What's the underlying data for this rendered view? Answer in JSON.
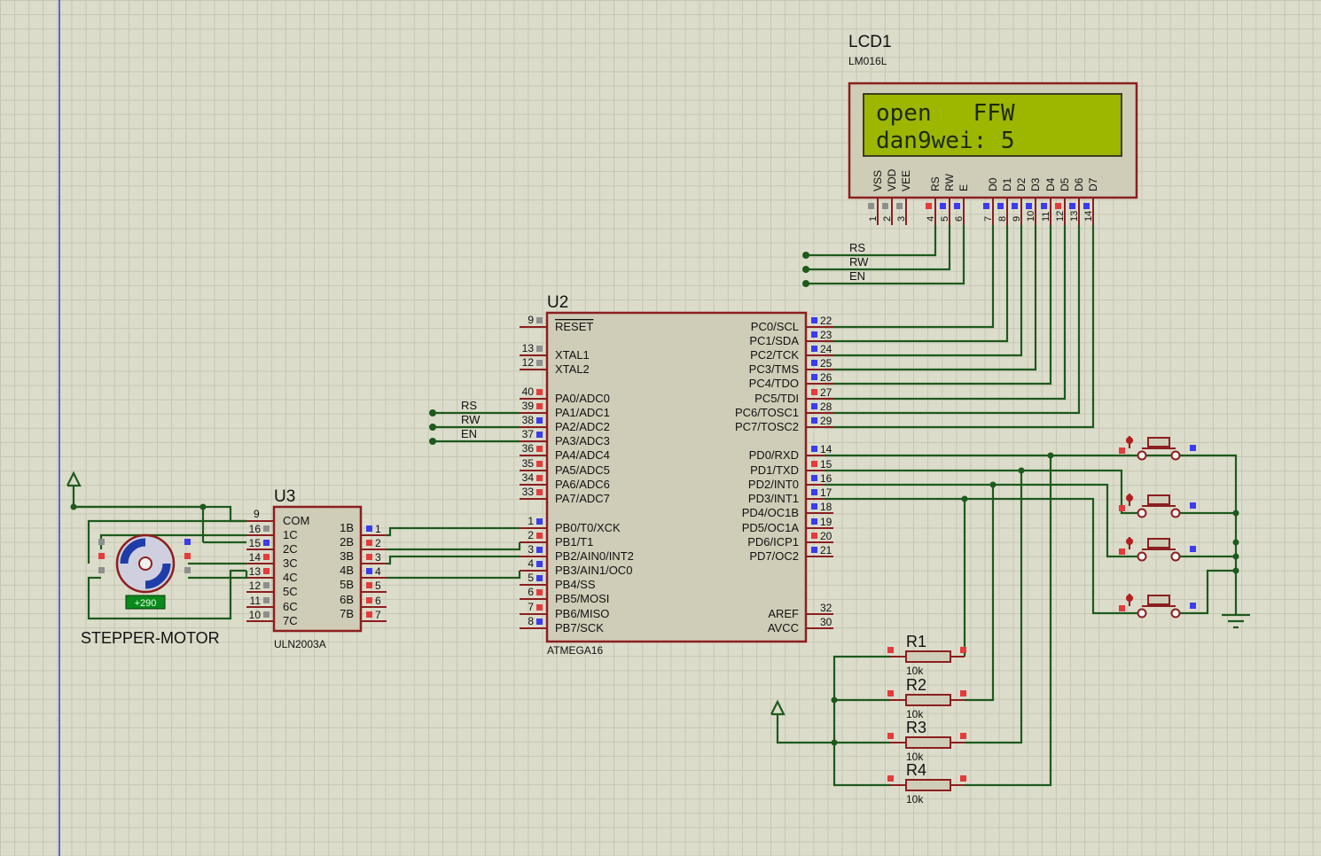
{
  "lcd": {
    "ref": "LCD1",
    "model": "LM016L",
    "line1": "open   FFW",
    "line2": "dan9wei: 5",
    "pin_labels": [
      "VSS",
      "VDD",
      "VEE",
      "RS",
      "RW",
      "E",
      "D0",
      "D1",
      "D2",
      "D3",
      "D4",
      "D5",
      "D6",
      "D7"
    ],
    "pin_numbers": [
      "1",
      "2",
      "3",
      "4",
      "5",
      "6",
      "7",
      "8",
      "9",
      "10",
      "11",
      "12",
      "13",
      "14"
    ]
  },
  "mcu": {
    "ref": "U2",
    "model": "ATMEGA16",
    "left_pins": [
      {
        "num": "9",
        "name": "RESET"
      },
      {
        "num": "13",
        "name": "XTAL1"
      },
      {
        "num": "12",
        "name": "XTAL2"
      },
      {
        "num": "40",
        "name": "PA0/ADC0"
      },
      {
        "num": "39",
        "name": "PA1/ADC1"
      },
      {
        "num": "38",
        "name": "PA2/ADC2"
      },
      {
        "num": "37",
        "name": "PA3/ADC3"
      },
      {
        "num": "36",
        "name": "PA4/ADC4"
      },
      {
        "num": "35",
        "name": "PA5/ADC5"
      },
      {
        "num": "34",
        "name": "PA6/ADC6"
      },
      {
        "num": "33",
        "name": "PA7/ADC7"
      },
      {
        "num": "1",
        "name": "PB0/T0/XCK"
      },
      {
        "num": "2",
        "name": "PB1/T1"
      },
      {
        "num": "3",
        "name": "PB2/AIN0/INT2"
      },
      {
        "num": "4",
        "name": "PB3/AIN1/OC0"
      },
      {
        "num": "5",
        "name": "PB4/SS"
      },
      {
        "num": "6",
        "name": "PB5/MOSI"
      },
      {
        "num": "7",
        "name": "PB6/MISO"
      },
      {
        "num": "8",
        "name": "PB7/SCK"
      }
    ],
    "right_pins": [
      {
        "num": "22",
        "name": "PC0/SCL"
      },
      {
        "num": "23",
        "name": "PC1/SDA"
      },
      {
        "num": "24",
        "name": "PC2/TCK"
      },
      {
        "num": "25",
        "name": "PC3/TMS"
      },
      {
        "num": "26",
        "name": "PC4/TDO"
      },
      {
        "num": "27",
        "name": "PC5/TDI"
      },
      {
        "num": "28",
        "name": "PC6/TOSC1"
      },
      {
        "num": "29",
        "name": "PC7/TOSC2"
      },
      {
        "num": "14",
        "name": "PD0/RXD"
      },
      {
        "num": "15",
        "name": "PD1/TXD"
      },
      {
        "num": "16",
        "name": "PD2/INT0"
      },
      {
        "num": "17",
        "name": "PD3/INT1"
      },
      {
        "num": "18",
        "name": "PD4/OC1B"
      },
      {
        "num": "19",
        "name": "PD5/OC1A"
      },
      {
        "num": "20",
        "name": "PD6/ICP1"
      },
      {
        "num": "21",
        "name": "PD7/OC2"
      },
      {
        "num": "32",
        "name": "AREF"
      },
      {
        "num": "30",
        "name": "AVCC"
      }
    ]
  },
  "driver": {
    "ref": "U3",
    "model": "ULN2003A",
    "com_label": "COM",
    "com_pin": "9",
    "left_pins": [
      {
        "num": "16",
        "name": "1C"
      },
      {
        "num": "15",
        "name": "2C"
      },
      {
        "num": "14",
        "name": "3C"
      },
      {
        "num": "13",
        "name": "4C"
      },
      {
        "num": "12",
        "name": "5C"
      },
      {
        "num": "11",
        "name": "6C"
      },
      {
        "num": "10",
        "name": "7C"
      }
    ],
    "right_pins": [
      {
        "num": "1",
        "name": "1B"
      },
      {
        "num": "2",
        "name": "2B"
      },
      {
        "num": "3",
        "name": "3B"
      },
      {
        "num": "4",
        "name": "4B"
      },
      {
        "num": "5",
        "name": "5B"
      },
      {
        "num": "6",
        "name": "6B"
      },
      {
        "num": "7",
        "name": "7B"
      }
    ]
  },
  "motor": {
    "label": "STEPPER-MOTOR",
    "angle": "+290"
  },
  "net_labels": {
    "lcd_side": [
      "RS",
      "RW",
      "EN"
    ],
    "mcu_side": [
      "RS",
      "RW",
      "EN"
    ]
  },
  "resistors": [
    {
      "ref": "R1",
      "value": "10k"
    },
    {
      "ref": "R2",
      "value": "10k"
    },
    {
      "ref": "R3",
      "value": "10k"
    },
    {
      "ref": "R4",
      "value": "10k"
    }
  ],
  "colors": {
    "wire": "#1d5a1d",
    "component_border": "#8b1f1f",
    "component_fill": "#cfcdb7",
    "lcd_screen": "#9db600",
    "pin_high": "#e53b3b",
    "pin_low": "#3b3bf0",
    "pin_float": "#8f8f8f",
    "margin_line": "#3c3ccc"
  }
}
